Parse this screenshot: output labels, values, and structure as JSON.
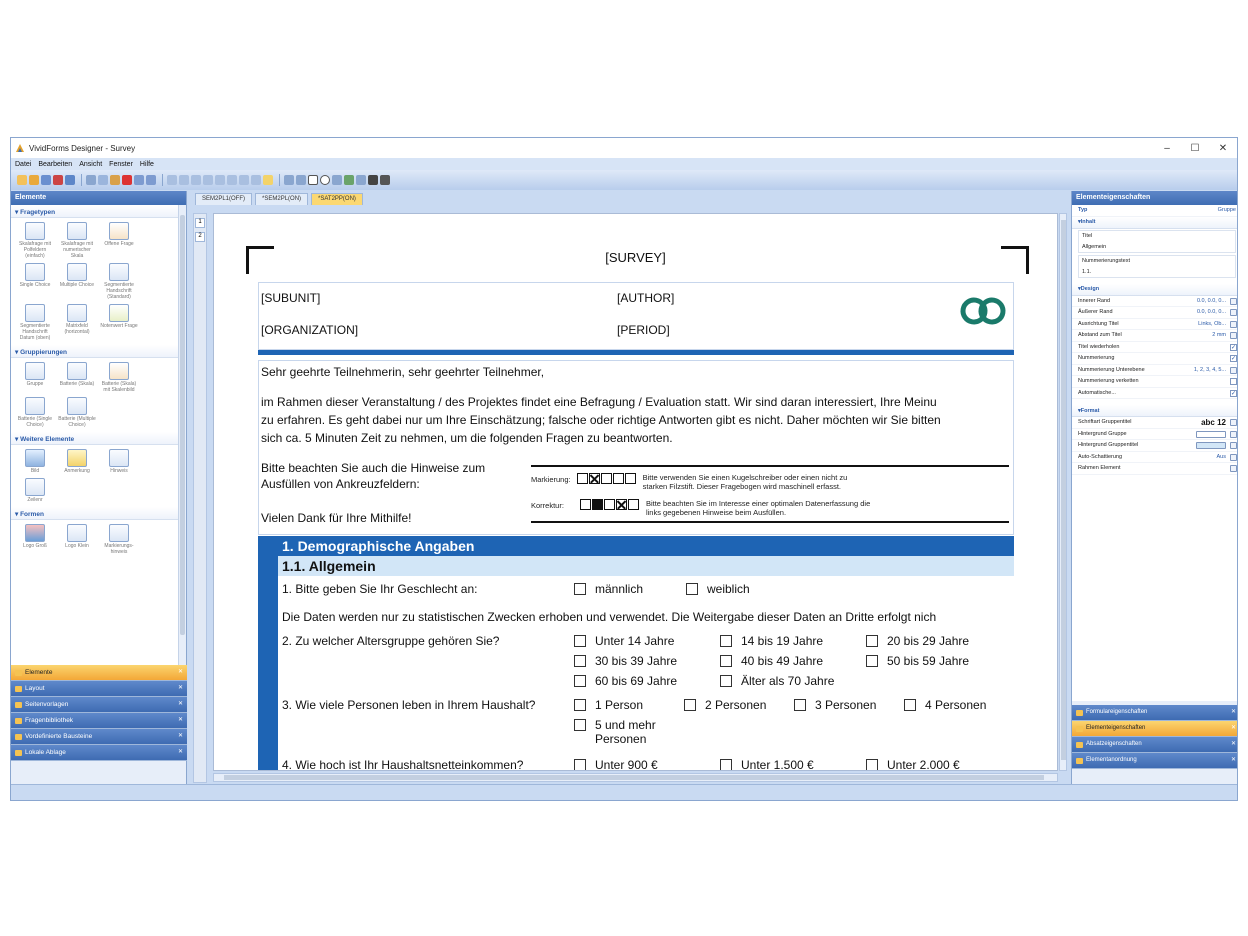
{
  "window": {
    "title": "VividForms Designer - Survey",
    "min": "–",
    "max": "☐",
    "close": "✕"
  },
  "menu": [
    "Datei",
    "Bearbeiten",
    "Ansicht",
    "Fenster",
    "Hilfe"
  ],
  "left_panel": {
    "title": "Elemente",
    "groups": [
      {
        "title": "Fragetypen",
        "items": [
          "Skalafrage mit Polfeldern (einfach)",
          "Skalafrage mit numerischer Skala",
          "Offene Frage",
          "Single Choice",
          "Multiple Choice",
          "Segmentierte Handschrift (Standard)",
          "Segmentierte Handschrift Datum (oben)",
          "Matrixfeld (horizontal)",
          "Notenwert Frage"
        ]
      },
      {
        "title": "Gruppierungen",
        "items": [
          "Gruppe",
          "Batterie (Skala)",
          "Batterie (Skala) mit Skalenbild",
          "Batterie (Single Choice)",
          "Batterie (Multiple Choice)"
        ]
      },
      {
        "title": "Weitere Elemente",
        "items": [
          "Bild",
          "Anmerkung",
          "Hinweis",
          "Zeilenr"
        ]
      },
      {
        "title": "Formen",
        "items": [
          "Logo Groß",
          "Logo Klein",
          "Markierungs-hinweis"
        ]
      }
    ],
    "tabs": [
      "Elemente",
      "Layout",
      "Seitenvorlagen",
      "Fragenbibliothek",
      "Vordefinierte Bausteine",
      "Lokale Ablage"
    ]
  },
  "doc_tabs": [
    "SEM2PL1(OFF)",
    "*SEM2PL(ON)",
    "*SAT2PP(ON)"
  ],
  "ruler_pages": [
    "1",
    "2"
  ],
  "page": {
    "title": "[SURVEY]",
    "subunit": "[SUBUNIT]",
    "author": "[AUTHOR]",
    "organization": "[ORGANIZATION]",
    "period": "[PERIOD]",
    "greeting": "Sehr geehrte Teilnehmerin, sehr geehrter Teilnehmer,",
    "intro_1": "im Rahmen dieser Veranstaltung / des Projektes findet eine Befragung / Evaluation statt. Wir sind daran interessiert, Ihre Meinu",
    "intro_2": "zu erfahren. Es geht dabei nur um Ihre Einschätzung; falsche oder richtige Antworten gibt es nicht. Daher möchten wir Sie bitten",
    "intro_3": "sich ca. 5 Minuten Zeit zu nehmen, um die folgenden Fragen zu beantworten.",
    "hint_1": "Bitte beachten Sie auch die Hinweise zum",
    "hint_2": "Ausfüllen von Ankreuzfeldern:",
    "thanks": "Vielen Dank für Ihre Mithilfe!",
    "mark_label": "Markierung:",
    "mark_text_1": "Bitte verwenden Sie einen Kugelschreiber oder einen nicht zu",
    "mark_text_2": "starken Filzstift. Dieser Fragebogen wird maschinell erfasst.",
    "corr_label": "Korrektur:",
    "corr_text_1": "Bitte beachten Sie im Interesse einer optimalen Datenerfassung die",
    "corr_text_2": "links gegebenen Hinweise beim Ausfüllen.",
    "section": "1. Demographische Angaben",
    "subsection": "1.1. Allgemein",
    "q1": "1.  Bitte geben Sie Ihr Geschlecht an:",
    "q1_opts": [
      "männlich",
      "weiblich"
    ],
    "note": "Die Daten werden nur zu statistischen Zwecken erhoben und verwendet. Die Weitergabe dieser Daten an Dritte erfolgt nich",
    "q2": "2.  Zu welcher Altersgruppe gehören Sie?",
    "q2_opts": [
      "Unter 14 Jahre",
      "14 bis 19 Jahre",
      "20 bis 29 Jahre",
      "30 bis 39 Jahre",
      "40 bis 49 Jahre",
      "50 bis 59 Jahre",
      "60 bis 69 Jahre",
      "Älter als 70 Jahre"
    ],
    "q3": "3.  Wie viele Personen leben in Ihrem Haushalt?",
    "q3_opts": [
      "1 Person",
      "2 Personen",
      "3 Personen",
      "4 Personen",
      "5 und mehr Personen"
    ],
    "q4": "4.  Wie hoch ist Ihr Haushaltsnetteinkommen?",
    "q4_opts": [
      "Unter 900 €",
      "Unter 1.500 €",
      "Unter 2.000 €"
    ]
  },
  "right_panel": {
    "title": "Elementeigenschaften",
    "type_label": "Typ",
    "type_value": "Gruppe",
    "cat_inhalt": "Inhalt",
    "titel_label": "Titel",
    "titel_value": "Allgemein",
    "nummer_label": "Nummerierungstext",
    "nummer_value": "1.1.",
    "cat_design": "Design",
    "design_rows": [
      {
        "k": "Innerer Rand",
        "v": "0.0, 0.0, 0..."
      },
      {
        "k": "Äußerer Rand",
        "v": "0.0, 0.0, 0..."
      },
      {
        "k": "Ausrichtung Titel",
        "v": "Links, Ob..."
      },
      {
        "k": "Abstand zum Titel",
        "v": "2 mm"
      },
      {
        "k": "Titel wiederholen",
        "v": ""
      },
      {
        "k": "Nummerierung",
        "v": ""
      },
      {
        "k": "Nummerierung Unterebene",
        "v": "1, 2, 3, 4, 5..."
      },
      {
        "k": "Nummerierung verketten",
        "v": ""
      },
      {
        "k": "Automatische...",
        "v": ""
      }
    ],
    "cat_format": "Format",
    "format_rows": [
      {
        "k": "Schriftart Gruppentitel",
        "v": "abc 12"
      },
      {
        "k": "Hintergrund Gruppe",
        "v": ""
      },
      {
        "k": "Hintergrund Gruppentitel",
        "v": ""
      },
      {
        "k": "Auto-Schattierung",
        "v": "Aus"
      },
      {
        "k": "Rahmen Element",
        "v": ""
      }
    ],
    "tabs": [
      "Formulareigenschaften",
      "Elementeigenschaften",
      "Absatzeigenschaften",
      "Elementanordnung"
    ]
  },
  "colors": {
    "accent": "#1e64b4",
    "subhead": "#d2e6f7",
    "logo": "#1a7a6a"
  }
}
